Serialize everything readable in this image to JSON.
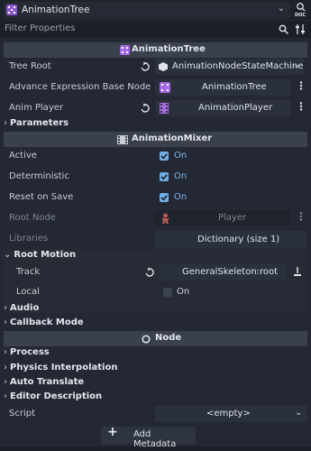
{
  "header": {
    "node_name": "AnimationTree",
    "doc_icon_text": "DOC"
  },
  "filter": {
    "placeholder": "Filter Properties"
  },
  "sections": {
    "animation_tree": "AnimationTree",
    "animation_mixer": "AnimationMixer",
    "node": "Node"
  },
  "animation_tree": {
    "tree_root": {
      "label": "Tree Root",
      "value": "AnimationNodeStateMachine"
    },
    "advance_expression": {
      "label": "Advance Expression Base Node",
      "value": "AnimationTree"
    },
    "anim_player": {
      "label": "Anim Player",
      "value": "AnimationPlayer"
    },
    "parameters": "Parameters"
  },
  "animation_mixer": {
    "active": {
      "label": "Active",
      "value": "On"
    },
    "deterministic": {
      "label": "Deterministic",
      "value": "On"
    },
    "reset_on_save": {
      "label": "Reset on Save",
      "value": "On"
    },
    "root_node": {
      "label": "Root Node",
      "value": "Player"
    },
    "libraries": {
      "label": "Libraries",
      "value": "Dictionary (size 1)"
    },
    "root_motion": {
      "title": "Root Motion",
      "track": {
        "label": "Track",
        "value": "GeneralSkeleton:root"
      },
      "local": {
        "label": "Local",
        "value": "On"
      }
    },
    "audio": "Audio",
    "callback_mode": "Callback Mode"
  },
  "node": {
    "process": "Process",
    "physics_interpolation": "Physics Interpolation",
    "auto_translate": "Auto Translate",
    "editor_description": "Editor Description",
    "script": {
      "label": "Script",
      "value": "<empty>"
    }
  },
  "add_metadata": "Add Metadata",
  "colors": {
    "accent": "#70aee6",
    "on_text": "#7eb5ea",
    "panel": "#232834",
    "section": "#3a414d",
    "icon_purple": "#a56ae0"
  }
}
